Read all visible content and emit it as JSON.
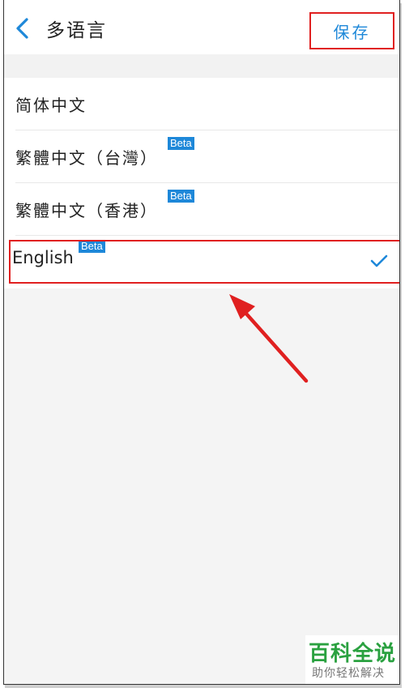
{
  "header": {
    "title": "多语言",
    "save_label": "保存"
  },
  "languages": [
    {
      "label": "简体中文",
      "beta": "",
      "selected": false
    },
    {
      "label": "繁體中文（台灣）",
      "beta": "Beta",
      "selected": false
    },
    {
      "label": "繁體中文（香港）",
      "beta": "Beta",
      "selected": false
    },
    {
      "label": "English",
      "beta": "Beta",
      "selected": true
    }
  ],
  "icons": {
    "back": "chevron-left-icon",
    "selected": "checkmark-icon",
    "annotation": "red-arrow-icon"
  },
  "colors": {
    "accent": "#1e88d9",
    "annotation": "#e02020",
    "watermark": "#2aa140"
  },
  "watermark": {
    "title": "百科全说",
    "subtitle": "助你轻松解决"
  }
}
